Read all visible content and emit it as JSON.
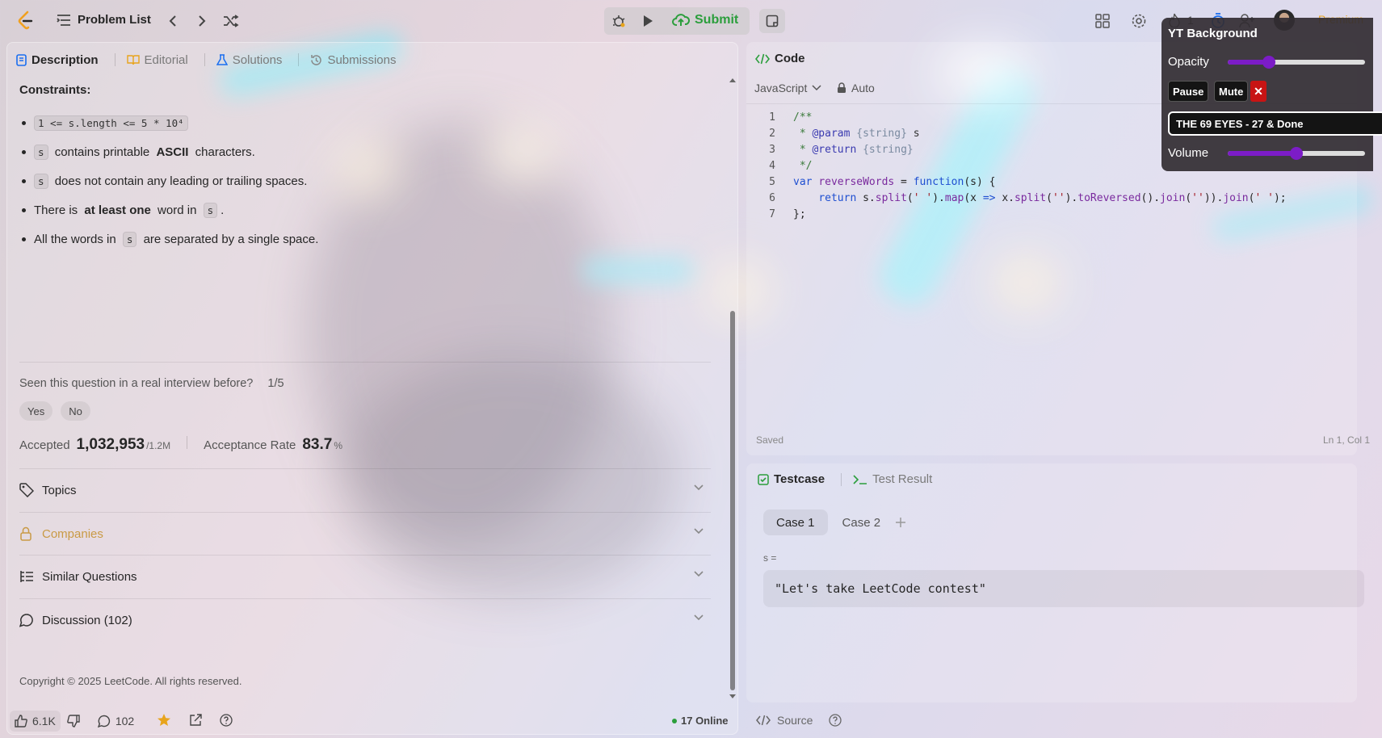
{
  "topbar": {
    "problem_list": "Problem List",
    "submit": "Submit",
    "streak_count": "1",
    "premium": "Premium"
  },
  "left": {
    "tabs": [
      "Description",
      "Editorial",
      "Solutions",
      "Submissions"
    ],
    "constraints_heading": "Constraints:",
    "bullets": [
      {
        "code": "1 <= s.length <= 5 * 10⁴"
      },
      {
        "code": "s",
        "text_before": "",
        "text_after": " contains printable ",
        "bold": "ASCII",
        "text_end": " characters."
      },
      {
        "code": "s",
        "text_after": " does not contain any leading or trailing spaces."
      },
      {
        "pre": "There is ",
        "bold": "at least one",
        "mid": " word in ",
        "code": "s",
        "end": "."
      },
      {
        "pre": "All the words in ",
        "code": "s",
        "end": " are separated by a single space."
      }
    ],
    "interview_q": "Seen this question in a real interview before?",
    "interview_count": "1/5",
    "yes": "Yes",
    "no": "No",
    "accepted_label": "Accepted",
    "accepted_value": "1,032,953",
    "accepted_total": "/1.2M",
    "rate_label": "Acceptance Rate",
    "rate_value": "83.7",
    "rate_unit": "%",
    "accordions": [
      "Topics",
      "Companies",
      "Similar Questions",
      "Discussion (102)"
    ],
    "copyright": "Copyright © 2025 LeetCode. All rights reserved.",
    "likes": "6.1K",
    "comments": "102",
    "online": "17 Online"
  },
  "code": {
    "title": "Code",
    "language": "JavaScript",
    "mode": "Auto",
    "saved": "Saved",
    "cursor": "Ln 1, Col 1",
    "lines": [
      "/**",
      " * @param {string} s",
      " * @return {string}",
      " */",
      "var reverseWords = function(s) {",
      "    return s.split(' ').map(x => x.split('').toReversed().join('')).join(' ');",
      "};"
    ]
  },
  "test": {
    "tab_testcase": "Testcase",
    "tab_result": "Test Result",
    "case1": "Case 1",
    "case2": "Case 2",
    "var_label": "s =",
    "var_value": "\"Let's take LeetCode contest\"",
    "source": "Source"
  },
  "yt": {
    "title": "YT Background",
    "opacity_label": "Opacity",
    "opacity_value": 0.3,
    "pause": "Pause",
    "mute": "Mute",
    "close": "✕",
    "track": "THE 69 EYES - 27 & Done",
    "volume_label": "Volume",
    "volume_value": 0.5
  }
}
